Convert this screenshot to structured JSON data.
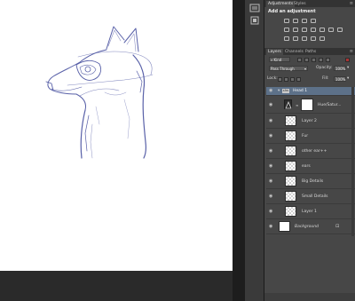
{
  "adjustments_panel": {
    "tabs": [
      {
        "label": "Adjustments",
        "active": true
      },
      {
        "label": "Styles",
        "active": false
      }
    ],
    "title": "Add an adjustment"
  },
  "layers_panel": {
    "tabs": [
      {
        "label": "Layers",
        "active": true
      },
      {
        "label": "Channels",
        "active": false
      },
      {
        "label": "Paths",
        "active": false
      }
    ],
    "filter": "Kind",
    "blend_mode": "Pass Through",
    "opacity_label": "Opacity:",
    "opacity_value": "100%",
    "lock_label": "Lock:",
    "fill_label": "Fill:",
    "fill_value": "100%",
    "group": {
      "name": "Head 1",
      "badge": "sfm"
    },
    "layers": [
      {
        "name": "Hue/Satur...",
        "type": "adjustment"
      },
      {
        "name": "Layer 2",
        "type": "pixel"
      },
      {
        "name": "Fur",
        "type": "pixel"
      },
      {
        "name": "other ear++",
        "type": "pixel"
      },
      {
        "name": "ears",
        "type": "pixel"
      },
      {
        "name": "Big Details",
        "type": "pixel"
      },
      {
        "name": "Small Details",
        "type": "pixel"
      },
      {
        "name": "Layer 1",
        "type": "pixel"
      },
      {
        "name": "Background",
        "type": "background"
      }
    ]
  },
  "colors": {
    "canvas": "#ffffff",
    "workspace": "#262626",
    "panel_bg": "#474747",
    "group_highlight": "#5d7189",
    "sketch_stroke": "#5860a8"
  }
}
